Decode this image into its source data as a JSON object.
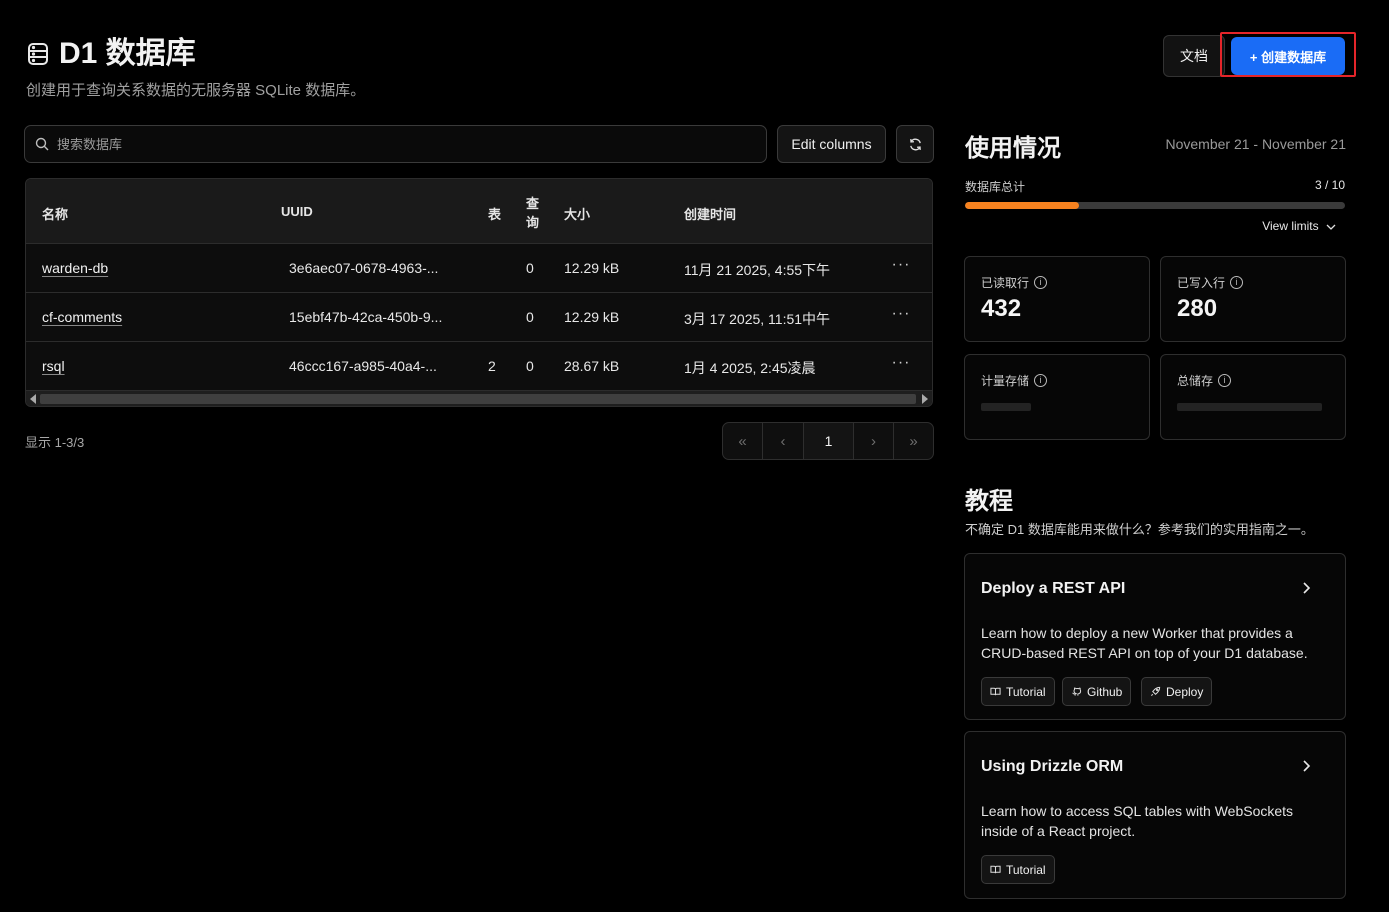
{
  "header": {
    "title": "D1 数据库",
    "subtitle": "创建用于查询关系数据的无服务器 SQLite 数据库。",
    "docs_label": "文档",
    "create_label": "+ 创建数据库"
  },
  "search": {
    "placeholder": "搜索数据库",
    "value": ""
  },
  "toolbar": {
    "edit_columns_label": "Edit columns"
  },
  "table": {
    "columns": {
      "name": "名称",
      "uuid": "UUID",
      "tables": "表",
      "queries": "查询",
      "size": "大小",
      "created": "创建时间"
    },
    "rows": [
      {
        "name": "warden-db",
        "uuid": "3e6aec07-0678-4963-...",
        "tables": "",
        "queries": "0",
        "size": "12.29 kB",
        "created": "11月 21 2025, 4:55下午",
        "more": "···"
      },
      {
        "name": "cf-comments",
        "uuid": "15ebf47b-42ca-450b-9...",
        "tables": "",
        "queries": "0",
        "size": "12.29 kB",
        "created": "3月 17 2025, 11:51中午",
        "more": "···"
      },
      {
        "name": "rsql",
        "uuid": "46ccc167-a985-40a4-...",
        "tables": "2",
        "queries": "0",
        "size": "28.67 kB",
        "created": "1月 4 2025, 2:45凌晨",
        "more": "···"
      }
    ]
  },
  "pagination": {
    "range_text": "显示 1-3/3",
    "first": "«",
    "prev": "‹",
    "current": "1",
    "next": "›",
    "last": "»"
  },
  "usage": {
    "title": "使用情况",
    "date_range": "November 21 - November 21",
    "db_total_label": "数据库总计",
    "db_total_count": "3 / 10",
    "db_total_fraction": 0.3,
    "view_limits_label": "View limits",
    "progress_color": "#f6821f",
    "cards": {
      "rows_read_label": "已读取行",
      "rows_read_value": "432",
      "rows_written_label": "已写入行",
      "rows_written_value": "280",
      "metered_storage_label": "计量存储",
      "total_storage_label": "总储存"
    }
  },
  "tutorials": {
    "title": "教程",
    "subtitle": "不确定 D1 数据库能用来做什么？参考我们的实用指南之一。",
    "items": [
      {
        "title": "Deploy a REST API",
        "description": "Learn how to deploy a new Worker that provides a CRUD-based REST API on top of your D1 database.",
        "chips": [
          "Tutorial",
          "Github",
          "Deploy"
        ]
      },
      {
        "title": "Using Drizzle ORM",
        "description": "Learn how to access SQL tables with WebSockets inside of a React project.",
        "chips": [
          "Tutorial"
        ]
      }
    ]
  },
  "colors": {
    "accent": "#1a6cf6",
    "highlight_border": "#e5252a",
    "background": "#000000"
  }
}
